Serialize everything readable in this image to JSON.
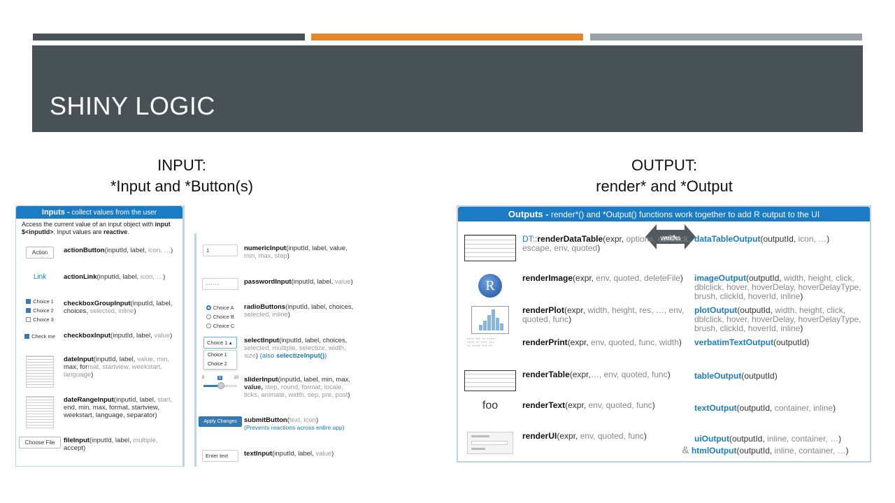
{
  "slide": {
    "title": "SHINY LOGIC",
    "left_heading_line1": "INPUT:",
    "left_heading_line2": "*Input and *Button(s)",
    "right_heading_line1": "OUTPUT:",
    "right_heading_line2": "render* and *Output"
  },
  "colors": {
    "accent": "#e6852a",
    "title_bg": "#475156",
    "grey_bar": "#99a1a6",
    "shiny_blue": "#1b7bc4"
  },
  "inputs": {
    "header_bold": "Inputs -",
    "header_rest": " collect values from the user",
    "intro_1": "Access the current value of an input object with ",
    "intro_b1": "input $<inputId>",
    "intro_2": ". Input values are ",
    "intro_b2": "reactive",
    "intro_3": ".",
    "items": [
      {
        "widget": "Action",
        "name": "actionButton",
        "args": "(inputId, label, ",
        "opt": "icon, …",
        "end": ")"
      },
      {
        "widget": "Link",
        "name": "actionLink",
        "args": "(inputId, label, ",
        "opt": "icon, …",
        "end": ")"
      },
      {
        "name": "checkboxGroupInput",
        "args": "(inputId, label, choices, ",
        "opt": "selected, inline",
        "end": ")"
      },
      {
        "widget": "Check me",
        "name": "checkboxInput",
        "args": "(inputId, label, ",
        "opt": "value",
        "end": ")"
      },
      {
        "name": "dateInput",
        "args": "(inputId, label, ",
        "opt": "value, min, ",
        "args2": "max, for",
        "opt2": "mat, startview, weekstart, language",
        "end": ")"
      },
      {
        "name": "dateRangeInput",
        "args": "(inputId, label, ",
        "opt": "start, ",
        "args2": "end, min, max, format, startview, weekstart, language, separator",
        "end": ")"
      },
      {
        "widget": "Choose File",
        "name": "fileInput",
        "args": "(inputId, label, ",
        "opt": "multiple, ",
        "args2": "accept",
        "end": ")"
      }
    ],
    "checkbox_choices": [
      "Choice 1",
      "Choice 2",
      "Choice 3"
    ],
    "items_b": [
      {
        "widget": "1",
        "name": "numericInput",
        "args": "(inputId, label, value, ",
        "opt": "min, max, step",
        "end": ")"
      },
      {
        "widget": "········",
        "name": "passwordInput",
        "args": "(inputId, label, ",
        "opt": "value",
        "end": ")"
      },
      {
        "name": "radioButtons",
        "args": "(inputId, label, choices, ",
        "opt": "selected, inline",
        "end": ")"
      },
      {
        "widget": "Choice 1",
        "name": "selectInput",
        "args": "(inputId, label, choices, ",
        "opt": "selected, multiple, selectize, width, size",
        "end": ") ",
        "link": "(also ",
        "link_b": "selectizeInput()",
        "link_end": ")"
      },
      {
        "name": "sliderInput",
        "args": "(inputId, label, min, max, ",
        "args2": "value, ",
        "opt": "step, round, format, locale, ticks, animate, width, sep, pre, post",
        "end": ")"
      },
      {
        "widget": "Apply Changes",
        "name": "submitButton",
        "args": "(",
        "opt": "text, icon",
        "end": ")",
        "note": "(Prevents reactions across entire app)"
      },
      {
        "widget": "Enter text",
        "name": "textInput",
        "args": "(inputId, label, ",
        "opt": "value",
        "end": ")"
      }
    ],
    "radio_choices": [
      "Choice A",
      "Choice B",
      "Choice C"
    ],
    "dropdown_choices": [
      "Choice 1",
      "Choice 2"
    ],
    "slider": {
      "min": "0",
      "value": "5",
      "max": "10"
    }
  },
  "outputs": {
    "header_bold": "Outputs -",
    "header_rest": " render*()  and *Output() functions work together to add R output to the UI",
    "works_with_1": "works",
    "works_with_2": "with",
    "logo_letter": "R",
    "foo_text": "foo",
    "rows": [
      {
        "pkg": "DT::",
        "r_name": "renderDataTable",
        "r_args": "(expr, ",
        "r_opt": "options, callback,  escape, env, quoted",
        "r_end": ")",
        "o_name": "dataTableOutput",
        "o_args": "(outputId, ",
        "o_opt": "icon, …",
        "o_end": ")"
      },
      {
        "r_name": "renderImage",
        "r_args": "(expr, ",
        "r_opt": "env, quoted, deleteFile",
        "r_end": ")",
        "o_name": "imageOutput",
        "o_args": "(outputId, ",
        "o_opt": "width, height, click, dblclick, hover, hoverDelay, hoverDelayType, brush, clickId, hoverId, inline",
        "o_end": ")"
      },
      {
        "r_name": "renderPlot",
        "r_args": "(expr, ",
        "r_opt": "width, height, res, …, env, quoted, func",
        "r_end": ")",
        "o_name": "plotOutput",
        "o_args": "(outputId, ",
        "o_opt": "width, height, click, dblclick, hover, hoverDelay, hoverDelayType, brush, clickId, hoverId, inline",
        "o_end": ")"
      },
      {
        "r_name": "renderPrint",
        "r_args": "(expr, ",
        "r_opt": "env, quoted, func, width",
        "r_end": ")",
        "o_name": "verbatimTextOutput",
        "o_args": "(outputId)",
        "o_opt": "",
        "o_end": ""
      },
      {
        "r_name": "renderTable",
        "r_args": "(expr,",
        "r_opt": "…, env, quoted, func",
        "r_end": ")",
        "o_name": "tableOutput",
        "o_args": "(outputId)",
        "o_opt": "",
        "o_end": ""
      },
      {
        "r_name": "renderText",
        "r_args": "(expr, ",
        "r_opt": "env, quoted, func",
        "r_end": ")",
        "o_name": "textOutput",
        "o_args": "(outputId, ",
        "o_opt": "container, inline",
        "o_end": ")"
      },
      {
        "r_name": "renderUI",
        "r_args": "(expr, ",
        "r_opt": "env, quoted, func",
        "r_end": ")",
        "o_name": "uiOutput",
        "o_args": "(outputId, ",
        "o_opt": "inline, container, …",
        "o_end": ")",
        "amp": "&",
        "o2_name": "htmlOutput",
        "o2_args": "(outputId, ",
        "o2_opt": "inline, container, …",
        "o2_end": ")"
      }
    ]
  }
}
